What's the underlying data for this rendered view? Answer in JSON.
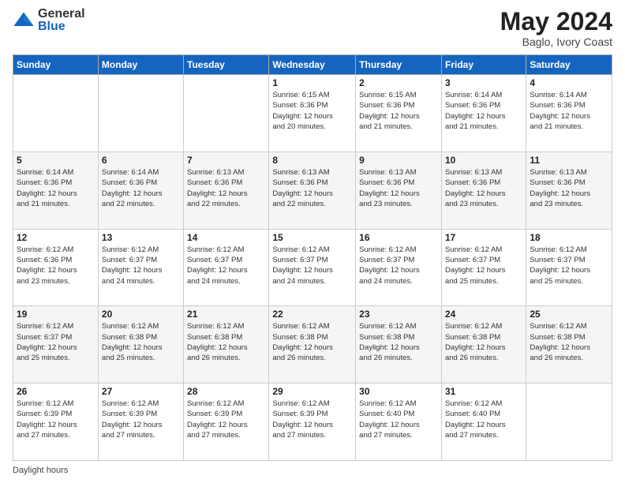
{
  "header": {
    "logo_general": "General",
    "logo_blue": "Blue",
    "month_year": "May 2024",
    "location": "Baglo, Ivory Coast"
  },
  "days_of_week": [
    "Sunday",
    "Monday",
    "Tuesday",
    "Wednesday",
    "Thursday",
    "Friday",
    "Saturday"
  ],
  "weeks": [
    [
      {
        "day": "",
        "info": ""
      },
      {
        "day": "",
        "info": ""
      },
      {
        "day": "",
        "info": ""
      },
      {
        "day": "1",
        "info": "Sunrise: 6:15 AM\nSunset: 6:36 PM\nDaylight: 12 hours\nand 20 minutes."
      },
      {
        "day": "2",
        "info": "Sunrise: 6:15 AM\nSunset: 6:36 PM\nDaylight: 12 hours\nand 21 minutes."
      },
      {
        "day": "3",
        "info": "Sunrise: 6:14 AM\nSunset: 6:36 PM\nDaylight: 12 hours\nand 21 minutes."
      },
      {
        "day": "4",
        "info": "Sunrise: 6:14 AM\nSunset: 6:36 PM\nDaylight: 12 hours\nand 21 minutes."
      }
    ],
    [
      {
        "day": "5",
        "info": "Sunrise: 6:14 AM\nSunset: 6:36 PM\nDaylight: 12 hours\nand 21 minutes."
      },
      {
        "day": "6",
        "info": "Sunrise: 6:14 AM\nSunset: 6:36 PM\nDaylight: 12 hours\nand 22 minutes."
      },
      {
        "day": "7",
        "info": "Sunrise: 6:13 AM\nSunset: 6:36 PM\nDaylight: 12 hours\nand 22 minutes."
      },
      {
        "day": "8",
        "info": "Sunrise: 6:13 AM\nSunset: 6:36 PM\nDaylight: 12 hours\nand 22 minutes."
      },
      {
        "day": "9",
        "info": "Sunrise: 6:13 AM\nSunset: 6:36 PM\nDaylight: 12 hours\nand 23 minutes."
      },
      {
        "day": "10",
        "info": "Sunrise: 6:13 AM\nSunset: 6:36 PM\nDaylight: 12 hours\nand 23 minutes."
      },
      {
        "day": "11",
        "info": "Sunrise: 6:13 AM\nSunset: 6:36 PM\nDaylight: 12 hours\nand 23 minutes."
      }
    ],
    [
      {
        "day": "12",
        "info": "Sunrise: 6:12 AM\nSunset: 6:36 PM\nDaylight: 12 hours\nand 23 minutes."
      },
      {
        "day": "13",
        "info": "Sunrise: 6:12 AM\nSunset: 6:37 PM\nDaylight: 12 hours\nand 24 minutes."
      },
      {
        "day": "14",
        "info": "Sunrise: 6:12 AM\nSunset: 6:37 PM\nDaylight: 12 hours\nand 24 minutes."
      },
      {
        "day": "15",
        "info": "Sunrise: 6:12 AM\nSunset: 6:37 PM\nDaylight: 12 hours\nand 24 minutes."
      },
      {
        "day": "16",
        "info": "Sunrise: 6:12 AM\nSunset: 6:37 PM\nDaylight: 12 hours\nand 24 minutes."
      },
      {
        "day": "17",
        "info": "Sunrise: 6:12 AM\nSunset: 6:37 PM\nDaylight: 12 hours\nand 25 minutes."
      },
      {
        "day": "18",
        "info": "Sunrise: 6:12 AM\nSunset: 6:37 PM\nDaylight: 12 hours\nand 25 minutes."
      }
    ],
    [
      {
        "day": "19",
        "info": "Sunrise: 6:12 AM\nSunset: 6:37 PM\nDaylight: 12 hours\nand 25 minutes."
      },
      {
        "day": "20",
        "info": "Sunrise: 6:12 AM\nSunset: 6:38 PM\nDaylight: 12 hours\nand 25 minutes."
      },
      {
        "day": "21",
        "info": "Sunrise: 6:12 AM\nSunset: 6:38 PM\nDaylight: 12 hours\nand 26 minutes."
      },
      {
        "day": "22",
        "info": "Sunrise: 6:12 AM\nSunset: 6:38 PM\nDaylight: 12 hours\nand 26 minutes."
      },
      {
        "day": "23",
        "info": "Sunrise: 6:12 AM\nSunset: 6:38 PM\nDaylight: 12 hours\nand 26 minutes."
      },
      {
        "day": "24",
        "info": "Sunrise: 6:12 AM\nSunset: 6:38 PM\nDaylight: 12 hours\nand 26 minutes."
      },
      {
        "day": "25",
        "info": "Sunrise: 6:12 AM\nSunset: 6:38 PM\nDaylight: 12 hours\nand 26 minutes."
      }
    ],
    [
      {
        "day": "26",
        "info": "Sunrise: 6:12 AM\nSunset: 6:39 PM\nDaylight: 12 hours\nand 27 minutes."
      },
      {
        "day": "27",
        "info": "Sunrise: 6:12 AM\nSunset: 6:39 PM\nDaylight: 12 hours\nand 27 minutes."
      },
      {
        "day": "28",
        "info": "Sunrise: 6:12 AM\nSunset: 6:39 PM\nDaylight: 12 hours\nand 27 minutes."
      },
      {
        "day": "29",
        "info": "Sunrise: 6:12 AM\nSunset: 6:39 PM\nDaylight: 12 hours\nand 27 minutes."
      },
      {
        "day": "30",
        "info": "Sunrise: 6:12 AM\nSunset: 6:40 PM\nDaylight: 12 hours\nand 27 minutes."
      },
      {
        "day": "31",
        "info": "Sunrise: 6:12 AM\nSunset: 6:40 PM\nDaylight: 12 hours\nand 27 minutes."
      },
      {
        "day": "",
        "info": ""
      }
    ]
  ],
  "footer": {
    "daylight_label": "Daylight hours"
  }
}
